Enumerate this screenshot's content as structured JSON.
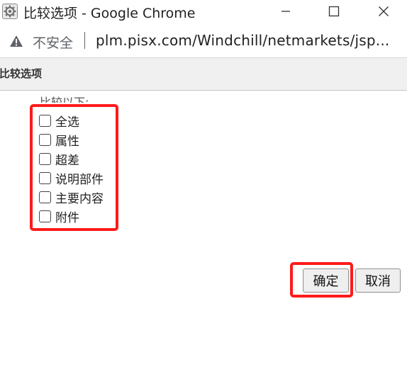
{
  "window": {
    "title": "比较选项 - Google Chrome",
    "app_icon": "gear-icon",
    "controls": [
      "minimize-icon",
      "maximize-icon",
      "close-icon"
    ]
  },
  "address_bar": {
    "security_icon": "warning-icon",
    "security_text": "不安全",
    "url": "plm.pisx.com/Windchill/netmarkets/jsp..."
  },
  "dialog": {
    "title": "比较选项",
    "compare_label": "比较以下:",
    "options": [
      {
        "label": "全选",
        "checked": false
      },
      {
        "label": "属性",
        "checked": false
      },
      {
        "label": "超差",
        "checked": false
      },
      {
        "label": "说明部件",
        "checked": false
      },
      {
        "label": "主要内容",
        "checked": false
      },
      {
        "label": "附件",
        "checked": false
      }
    ],
    "ok_label": "确定",
    "cancel_label": "取消"
  },
  "highlight_color": "#ff1a1a"
}
